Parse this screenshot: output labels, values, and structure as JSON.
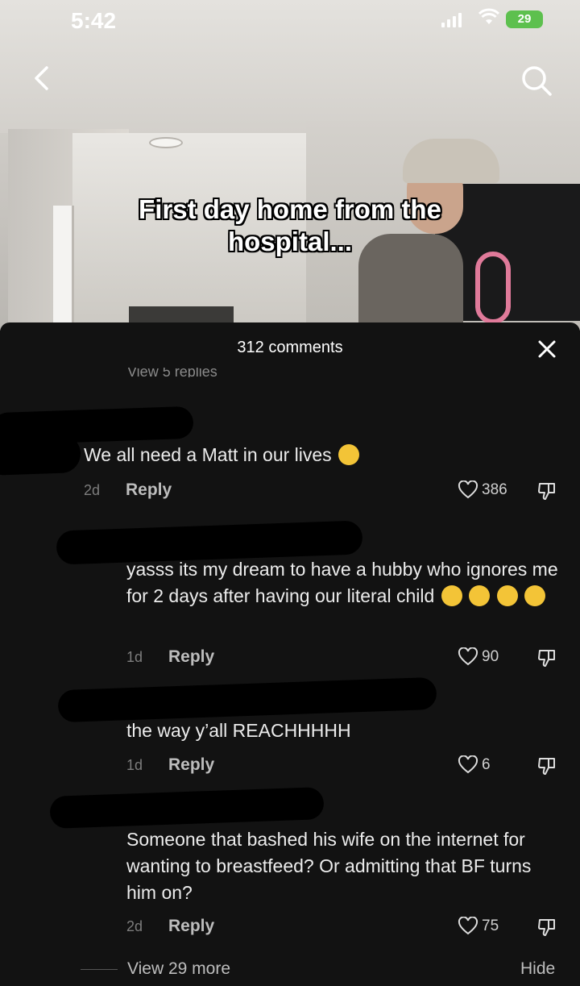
{
  "status_bar": {
    "time": "5:42",
    "battery": "29"
  },
  "video": {
    "caption": "First day home from the hospital..."
  },
  "sheet": {
    "title": "312 comments",
    "partial_replies": "View 5 replies",
    "comments": [
      {
        "text": "We all need a Matt in our lives",
        "date": "2d",
        "reply": "Reply",
        "likes": "386",
        "emoji": [
          "crying-face-emoji"
        ]
      },
      {
        "text": "yasss its my dream to have a hubby who ignores me for 2 days after having our literal child",
        "date": "1d",
        "reply": "Reply",
        "likes": "90",
        "emoji": [
          "heart-eyes-emoji",
          "star-struck-emoji",
          "winking-tongue-emoji",
          "zany-face-emoji"
        ]
      },
      {
        "text": "the way y’all REACHHHHH",
        "date": "1d",
        "reply": "Reply",
        "likes": "6"
      },
      {
        "text": "Someone that bashed his wife on the internet for wanting to breastfeed? Or admitting that BF turns him on?",
        "date": "2d",
        "reply": "Reply",
        "likes": "75"
      }
    ],
    "footer": {
      "view_more": "View 29 more",
      "hide": "Hide"
    }
  }
}
